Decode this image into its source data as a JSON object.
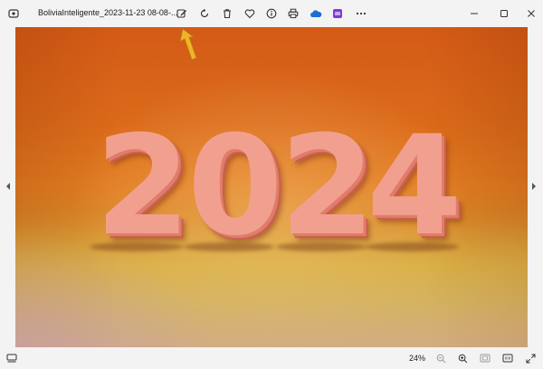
{
  "window": {
    "file_name": "BoliviaInteligente_2023-11-23 08-08-...",
    "zoom_level": "24%"
  },
  "toolbar": {
    "items": [
      "app-icon",
      "edit-icon",
      "rotate-icon",
      "delete-icon",
      "favorite-icon",
      "info-icon",
      "print-icon",
      "onedrive-icon",
      "clipchamp-icon",
      "more-icon"
    ]
  },
  "window_controls": [
    "minimize-icon",
    "maximize-icon",
    "close-icon"
  ],
  "image": {
    "digits": [
      "2",
      "0",
      "2",
      "4"
    ],
    "palette": {
      "background": "#db6a1a",
      "floor": "#cdb24c",
      "digit": "#f1a08f"
    }
  },
  "bottom_bar": {
    "items": [
      "filmstrip-icon",
      "zoom-out-icon",
      "zoom-in-icon",
      "fit-icon",
      "actual-size-icon",
      "fullscreen-icon"
    ]
  },
  "annotation": {
    "color": "#f0b42a",
    "points_to": "edit-icon"
  }
}
